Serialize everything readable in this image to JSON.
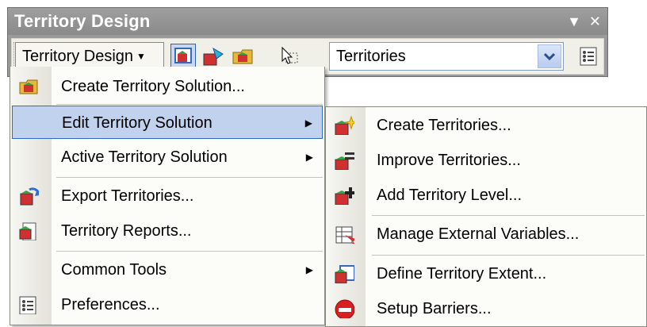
{
  "window": {
    "title": "Territory Design",
    "buttons": {
      "dropdown": "▼",
      "close": "✕"
    }
  },
  "toolbar": {
    "menu_button_label": "Territory Design",
    "layer_combo_value": "Territories",
    "icons": [
      "territory-view-icon",
      "territory-draw-icon",
      "territory-folder-icon",
      "select-pointer-icon",
      "options-list-icon"
    ]
  },
  "main_menu": {
    "items": [
      {
        "label": "Create Territory Solution...",
        "icon": "open-folder-map-icon"
      },
      {
        "label": "Edit Territory Solution",
        "submenu": true,
        "highlighted": true
      },
      {
        "label": "Active Territory Solution",
        "submenu": true
      },
      {
        "label": "Export Territories...",
        "icon": "export-map-icon"
      },
      {
        "label": "Territory Reports...",
        "icon": "report-map-icon"
      },
      {
        "label": "Common Tools",
        "submenu": true
      },
      {
        "label": "Preferences...",
        "icon": "preferences-list-icon"
      }
    ]
  },
  "sub_menu": {
    "items": [
      {
        "label": "Create Territories...",
        "icon": "create-territories-icon"
      },
      {
        "label": "Improve Territories...",
        "icon": "improve-territories-icon"
      },
      {
        "label": "Add Territory Level...",
        "icon": "add-level-icon"
      },
      {
        "label": "Manage External Variables...",
        "icon": "external-variables-icon"
      },
      {
        "label": "Define Territory Extent...",
        "icon": "define-extent-icon"
      },
      {
        "label": "Setup Barriers...",
        "icon": "barrier-icon"
      }
    ]
  },
  "colors": {
    "highlight": "#c1d2ee",
    "highlight_border": "#316ac5",
    "title_bar": "#9a9a9a"
  }
}
